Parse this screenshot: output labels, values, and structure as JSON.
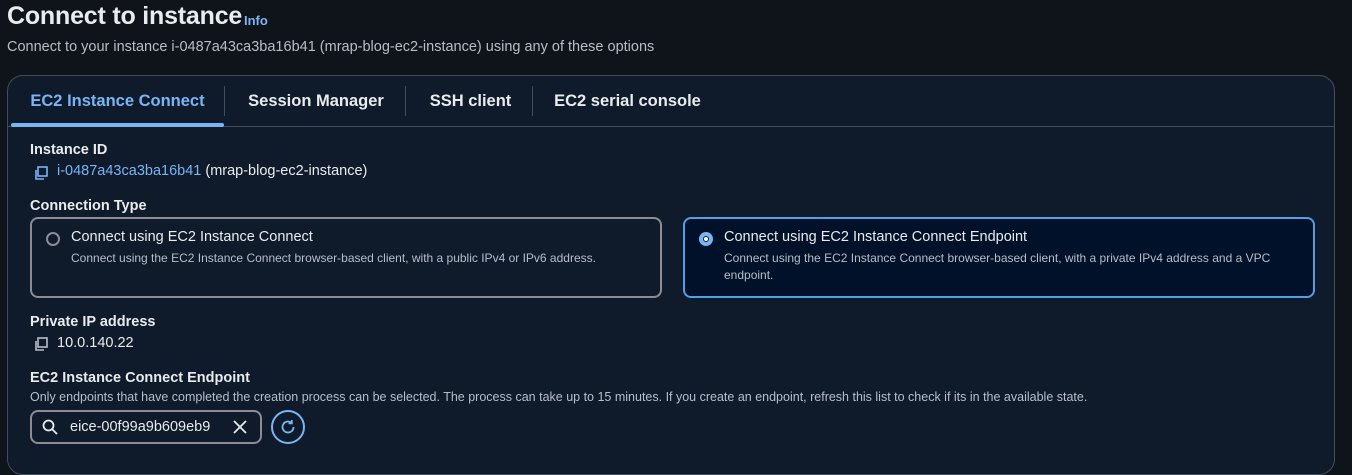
{
  "header": {
    "title": "Connect to instance",
    "info_label": "Info",
    "subtitle": "Connect to your instance i-0487a43ca3ba16b41 (mrap-blog-ec2-instance) using any of these options"
  },
  "tabs": [
    {
      "label": "EC2 Instance Connect",
      "active": true
    },
    {
      "label": "Session Manager",
      "active": false
    },
    {
      "label": "SSH client",
      "active": false
    },
    {
      "label": "EC2 serial console",
      "active": false
    }
  ],
  "instance": {
    "label": "Instance ID",
    "id": "i-0487a43ca3ba16b41",
    "name": "(mrap-blog-ec2-instance)"
  },
  "connection_type": {
    "label": "Connection Type",
    "options": [
      {
        "title": "Connect using EC2 Instance Connect",
        "description": "Connect using the EC2 Instance Connect browser-based client, with a public IPv4 or IPv6 address.",
        "selected": false
      },
      {
        "title": "Connect using EC2 Instance Connect Endpoint",
        "description": "Connect using the EC2 Instance Connect browser-based client, with a private IPv4 address and a VPC endpoint.",
        "selected": true
      }
    ]
  },
  "private_ip": {
    "label": "Private IP address",
    "value": "10.0.140.22"
  },
  "endpoint": {
    "label": "EC2 Instance Connect Endpoint",
    "description": "Only endpoints that have completed the creation process can be selected. The process can take up to 15 minutes. If you create an endpoint, refresh this list to check if its in the available state.",
    "search_value": "eice-00f99a9b609eb9"
  },
  "colors": {
    "background": "#0f141a",
    "panel": "#0f1b2a",
    "accent": "#7ab4f5",
    "border": "#414d5c",
    "selected_bg": "#001129"
  },
  "icons": [
    "copy-icon",
    "search-icon",
    "close-icon",
    "refresh-icon",
    "radio-icon"
  ]
}
